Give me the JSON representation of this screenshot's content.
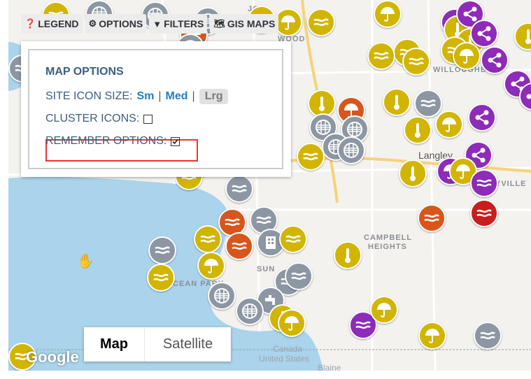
{
  "toolbar": {
    "legend_label": "LEGEND",
    "options_label": "OPTIONS",
    "filters_label": "FILTERS",
    "gis_maps_label": "GIS MAPS"
  },
  "map_options": {
    "title": "MAP OPTIONS",
    "site_icon_size_label": "SITE ICON SIZE:",
    "size_sm": "Sm",
    "size_med": "Med",
    "size_lrg": "Lrg",
    "size_selected": "Lrg",
    "separator": "|",
    "cluster_icons_label": "CLUSTER ICONS:",
    "cluster_icons_checked": false,
    "remember_options_label": "REMEMBER OPTIONS:",
    "remember_options_checked": true
  },
  "map_type": {
    "map_label": "Map",
    "satellite_label": "Satellite",
    "selected": "Map"
  },
  "map_labels": {
    "langley": "Langley",
    "campbell_heights_1": "CAMPBELL",
    "campbell_heights_2": "HEIGHTS",
    "willoughby": "WILLOUGHBY",
    "yville": "YVILLE",
    "ocean_park": "CEAN PARK",
    "sunnyside": "SUN",
    "johnston": "JOH",
    "wood": "WOOD",
    "canada": "Canada",
    "united_states": "United States",
    "blaine": "Blaine",
    "google": "Google"
  },
  "colors": {
    "yellow_marker": "#d2b500",
    "gray_marker": "#8d97a3",
    "purple_marker": "#8e2bb8",
    "orange_marker": "#d8561c",
    "red_marker": "#c91e1e",
    "water": "#aad3ec",
    "highlight_border": "#e33333",
    "panel_text": "#3e5e80",
    "link_blue": "#1d7fc1"
  }
}
